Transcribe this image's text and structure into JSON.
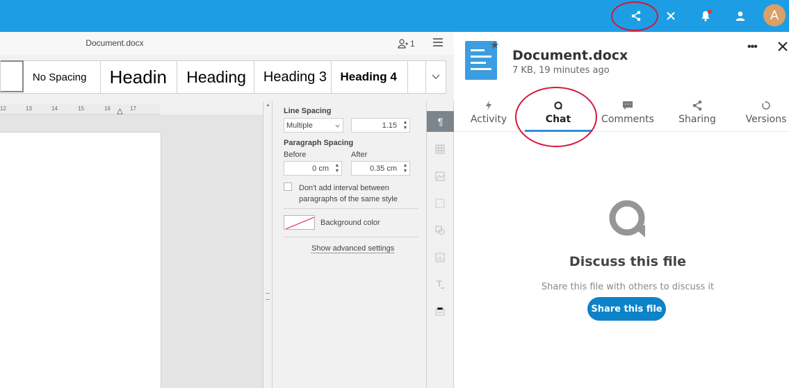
{
  "topbar": {
    "avatar_letter": "A",
    "accent_color": "#1d9ee4"
  },
  "editor": {
    "doc_title": "Document.docx",
    "users_count": "1",
    "styles": [
      "No Spacing",
      "Headin",
      "Heading",
      "Heading 3",
      "Heading 4"
    ],
    "ruler_ticks": [
      "12",
      "13",
      "14",
      "15",
      "16",
      "17"
    ],
    "paragraph": {
      "line_spacing_label": "Line Spacing",
      "line_spacing_mode": "Multiple",
      "line_spacing_value": "1.15",
      "paragraph_spacing_label": "Paragraph Spacing",
      "before_label": "Before",
      "after_label": "After",
      "before_value": "0 cm",
      "after_value": "0.35 cm",
      "checkbox_label_1": "Don't add interval between",
      "checkbox_label_2": "paragraphs of the same style",
      "bg_color_label": "Background color",
      "advanced_link": "Show advanced settings"
    }
  },
  "sidebar": {
    "file_name": "Document.docx",
    "file_meta": "7 KB, 19 minutes ago",
    "tabs": [
      {
        "label": "Activity",
        "icon": "activity-icon"
      },
      {
        "label": "Chat",
        "icon": "chat-icon"
      },
      {
        "label": "Comments",
        "icon": "comments-icon"
      },
      {
        "label": "Sharing",
        "icon": "share-icon"
      },
      {
        "label": "Versions",
        "icon": "history-icon"
      }
    ],
    "active_tab": "Chat",
    "empty_title": "Discuss this file",
    "empty_subtitle": "Share this file with others to discuss it",
    "share_button": "Share this file",
    "button_color": "#0c82c9"
  },
  "annotations": {
    "highlight_color": "#d6163b"
  }
}
